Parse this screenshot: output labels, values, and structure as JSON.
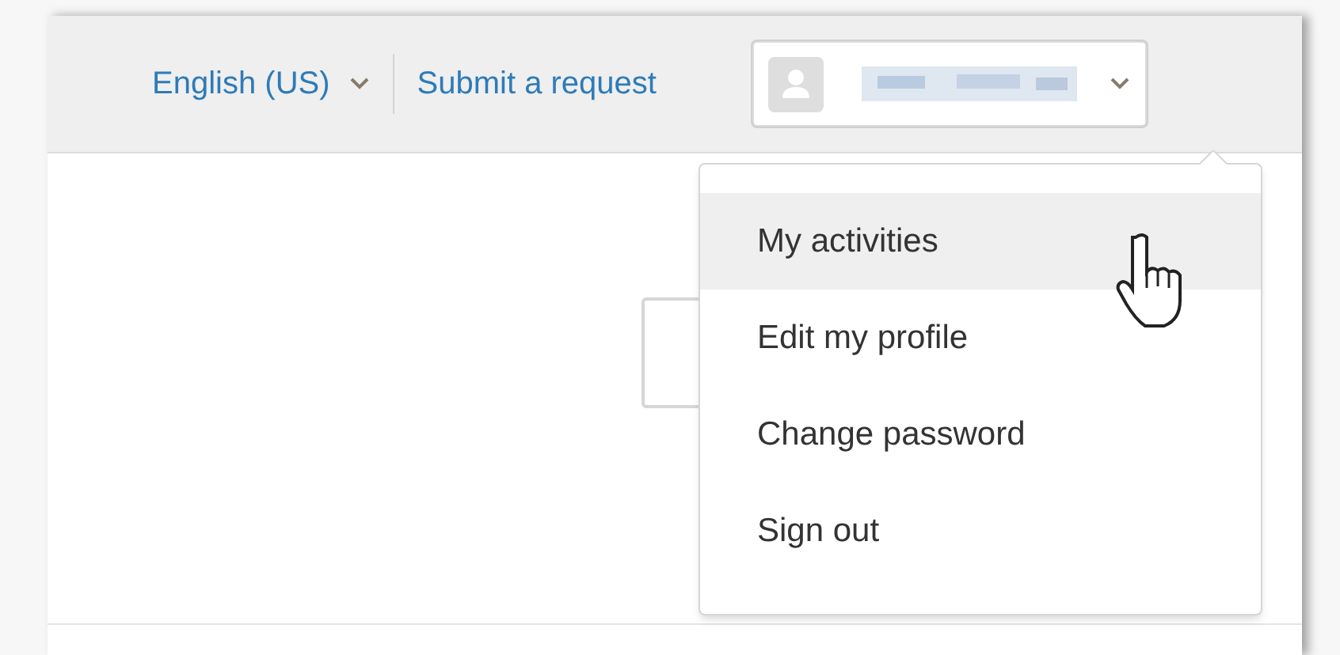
{
  "header": {
    "language": "English (US)",
    "submit_link": "Submit a request",
    "user_menu": {
      "expanded": true
    }
  },
  "menu": {
    "items": [
      {
        "label": "My activities",
        "hovered": true
      },
      {
        "label": "Edit my profile",
        "hovered": false
      },
      {
        "label": "Change password",
        "hovered": false
      },
      {
        "label": "Sign out",
        "hovered": false
      }
    ]
  }
}
